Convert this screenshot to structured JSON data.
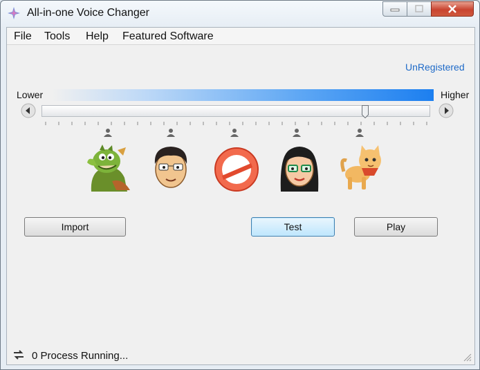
{
  "window": {
    "title": "All-in-one Voice Changer"
  },
  "menu": [
    "File",
    "Tools",
    "Help",
    "Featured Software"
  ],
  "registration": "UnRegistered",
  "pitch": {
    "lower_label": "Lower",
    "higher_label": "Higher",
    "level": 0.83
  },
  "presets": [
    {
      "name": "dragon-avatar"
    },
    {
      "name": "man-avatar"
    },
    {
      "name": "no-effect-icon"
    },
    {
      "name": "woman-avatar"
    },
    {
      "name": "cat-avatar"
    }
  ],
  "buttons": {
    "import": "Import",
    "test": "Test",
    "play": "Play"
  },
  "status": {
    "text": "0 Process Running..."
  },
  "colors": {
    "link": "#1e6ac8",
    "gradient_end": "#1c7ff0",
    "focus_border": "#3c7fb1"
  }
}
